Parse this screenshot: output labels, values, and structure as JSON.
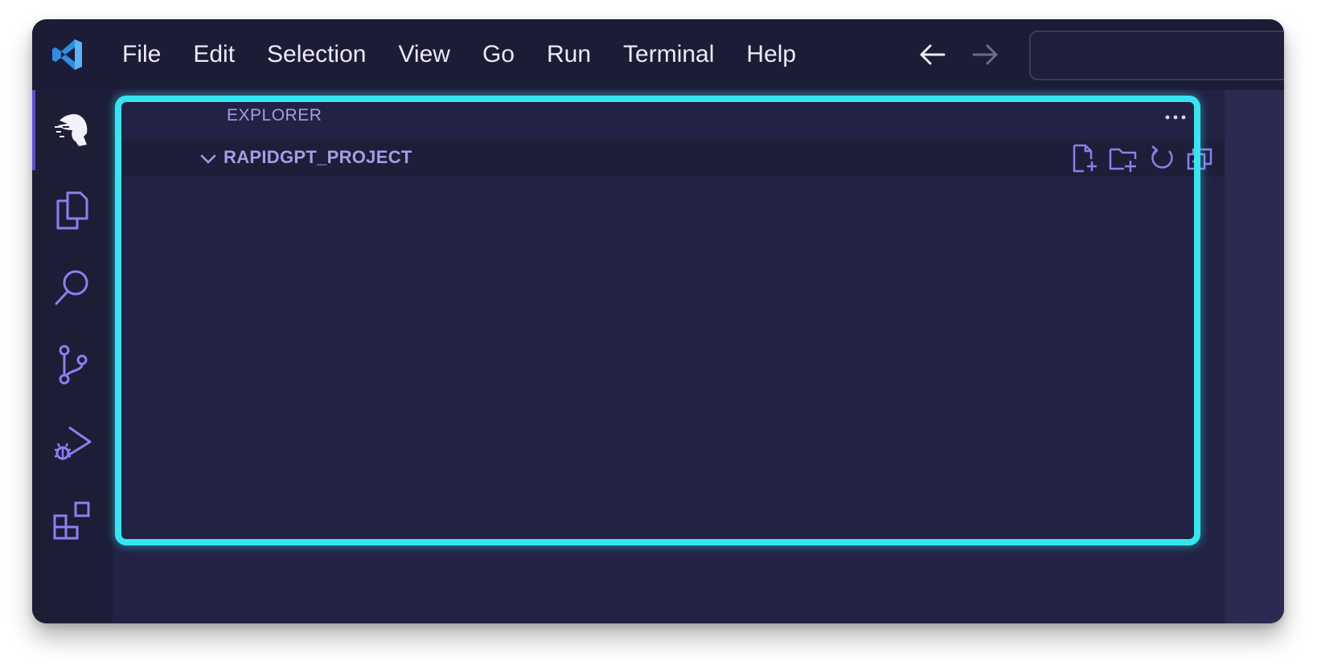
{
  "menu": {
    "items": [
      "File",
      "Edit",
      "Selection",
      "View",
      "Go",
      "Run",
      "Terminal",
      "Help"
    ]
  },
  "explorer": {
    "title": "EXPLORER",
    "section_label": "RAPIDGPT_PROJECT"
  },
  "icons": {
    "app": "vscode-logo-icon",
    "back": "arrow-left-icon",
    "forward": "arrow-right-icon",
    "activity": [
      "rapidgpt-icon",
      "files-icon",
      "search-icon",
      "source-control-icon",
      "run-debug-icon",
      "extensions-icon"
    ],
    "section_actions": [
      "new-file-icon",
      "new-folder-icon",
      "refresh-icon",
      "collapse-all-icon"
    ]
  },
  "colors": {
    "accent": "#8e7ef0",
    "highlight": "#35e6f0",
    "text": "#eeeaf8",
    "label": "#a99be6"
  }
}
